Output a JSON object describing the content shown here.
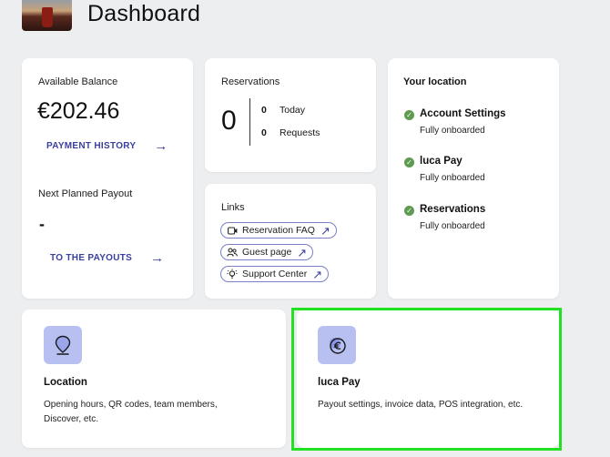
{
  "header": {
    "title": "Dashboard"
  },
  "balance": {
    "label": "Available Balance",
    "amount": "€202.46",
    "history_link": "PAYMENT HISTORY",
    "arrow": "→",
    "next_payout_label": "Next Planned Payout",
    "next_payout_value": "-",
    "payouts_link": "TO THE PAYOUTS"
  },
  "reservations": {
    "label": "Reservations",
    "total": "0",
    "today_count": "0",
    "today_label": "Today",
    "requests_count": "0",
    "requests_label": "Requests"
  },
  "links": {
    "label": "Links",
    "items": [
      {
        "label": "Reservation FAQ",
        "icon": "video-icon"
      },
      {
        "label": "Guest page",
        "icon": "guests-icon"
      },
      {
        "label": "Support Center",
        "icon": "lightbulb-icon"
      }
    ],
    "external_glyph": "↗"
  },
  "location": {
    "label": "Your location",
    "items": [
      {
        "title": "Account Settings",
        "status": "Fully onboarded"
      },
      {
        "title": "luca Pay",
        "status": "Fully onboarded"
      },
      {
        "title": "Reservations",
        "status": "Fully onboarded"
      }
    ],
    "check_glyph": "✓"
  },
  "tiles": [
    {
      "title": "Location",
      "description": "Opening hours, QR codes, team members, Discover, etc.",
      "icon": "location-pin-icon"
    },
    {
      "title": "luca Pay",
      "description": "Payout settings, invoice data, POS integration, etc.",
      "icon": "euro-coin-icon"
    }
  ],
  "colors": {
    "accent": "#3a3f9e",
    "success": "#5e9a4f",
    "tile_icon_bg": "#b8c0f2",
    "highlight": "#22e022"
  }
}
